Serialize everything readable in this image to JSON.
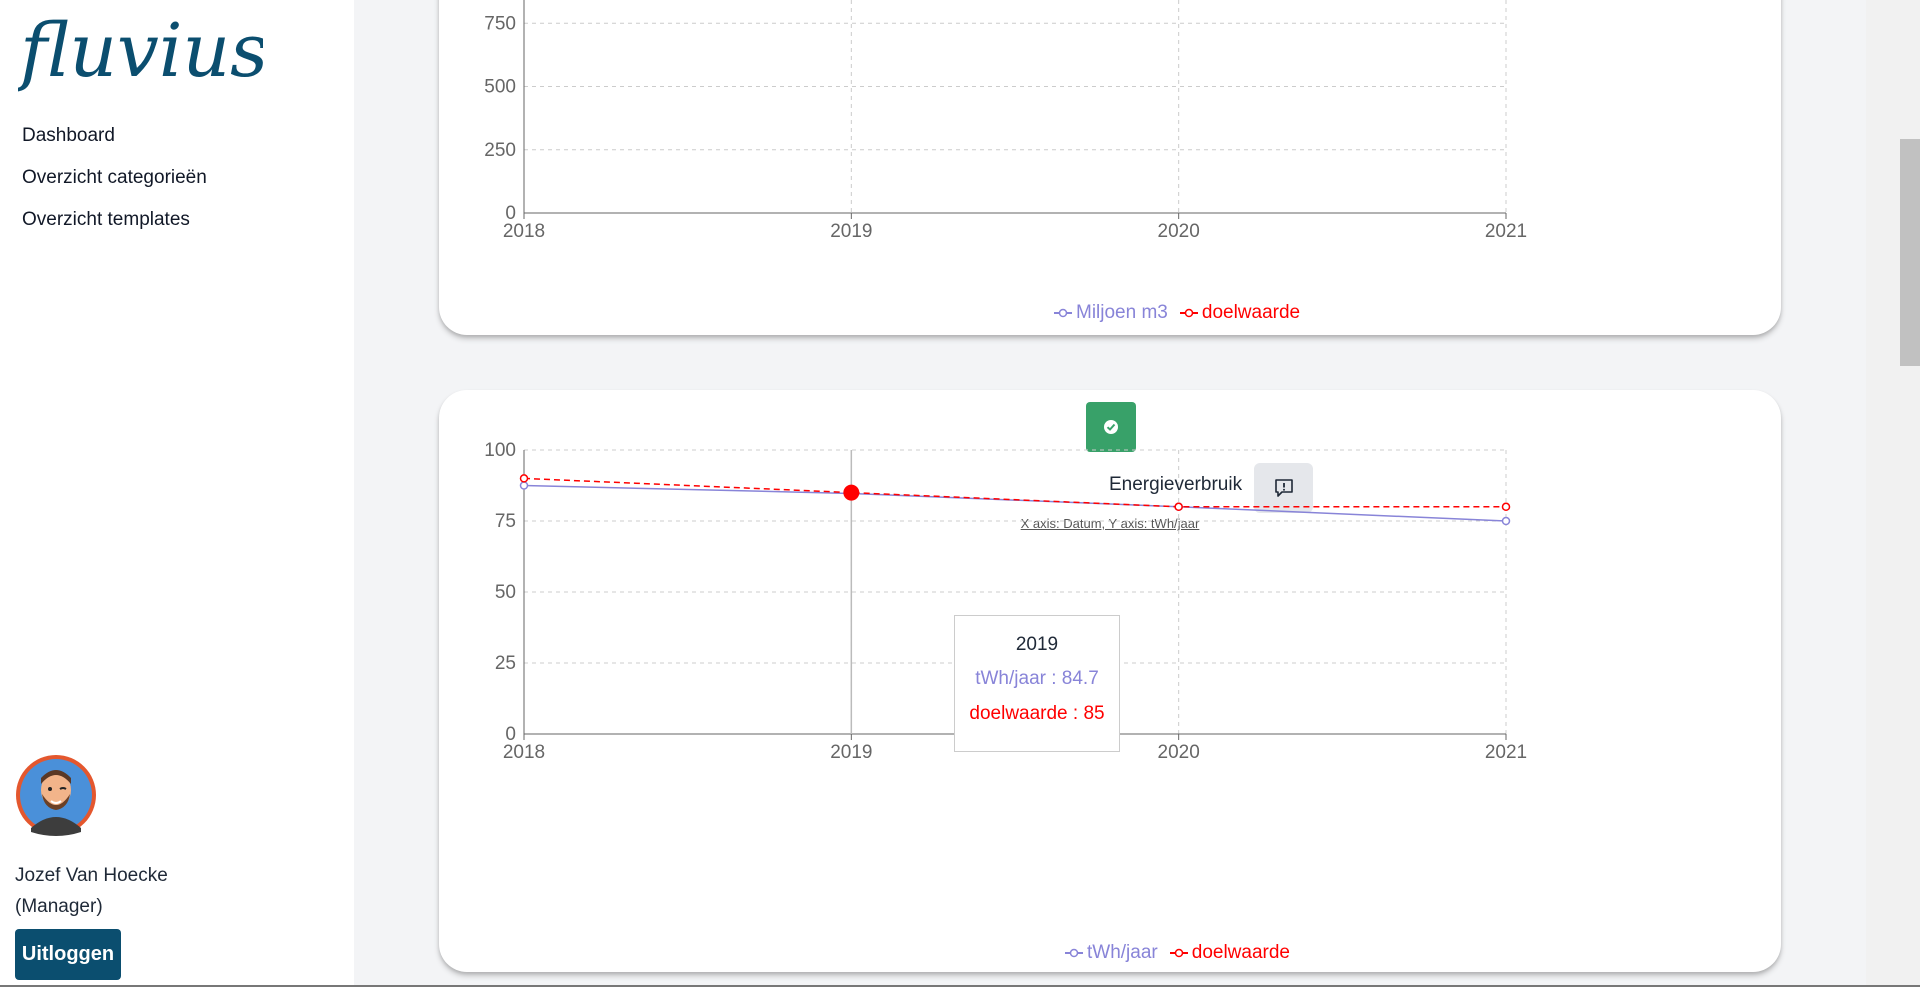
{
  "app": {
    "logo_text": "fluvius."
  },
  "sidebar": {
    "nav": [
      {
        "label": "Dashboard"
      },
      {
        "label": "Overzicht categorieën"
      },
      {
        "label": "Overzicht templates"
      }
    ],
    "user": {
      "name": "Jozef Van Hoecke",
      "role": "(Manager)"
    },
    "logout_label": "Uitloggen"
  },
  "charts": {
    "chart1": {
      "title": "",
      "axis_note": "",
      "legend": [
        {
          "name": "Miljoen m3",
          "color": "#8884d8"
        },
        {
          "name": "doelwaarde",
          "color": "#ff0000"
        }
      ]
    },
    "chart2": {
      "title": "Energieverbruik",
      "axis_note": "X axis: Datum, Y axis: tWh/jaar",
      "legend": [
        {
          "name": "tWh/jaar",
          "color": "#8884d8"
        },
        {
          "name": "doelwaarde",
          "color": "#ff0000"
        }
      ],
      "tooltip": {
        "year": "2019",
        "series_line": "tWh/jaar : 84.7",
        "target_line": "doelwaarde : 85"
      }
    }
  },
  "colors": {
    "brand": "#0b4e6f",
    "success": "#38a169",
    "series": "#8884d8",
    "target": "#ff0000"
  },
  "chart_data": [
    {
      "type": "line",
      "title": "",
      "x": [
        "2018",
        "2019",
        "2020",
        "2021"
      ],
      "xlabel": "",
      "ylabel": "",
      "yticks": [
        0,
        250,
        500,
        750
      ],
      "ylim": [
        0,
        1000
      ],
      "grid": true,
      "legend_position": "bottom",
      "series": [
        {
          "name": "Miljoen m3",
          "values": []
        },
        {
          "name": "doelwaarde",
          "values": []
        }
      ]
    },
    {
      "type": "line",
      "title": "Energieverbruik",
      "x": [
        "2018",
        "2019",
        "2020",
        "2021"
      ],
      "xlabel": "Datum",
      "ylabel": "tWh/jaar",
      "yticks": [
        0,
        25,
        50,
        75,
        100
      ],
      "ylim": [
        0,
        100
      ],
      "grid": true,
      "legend_position": "bottom",
      "series": [
        {
          "name": "tWh/jaar",
          "values": [
            87.5,
            84.7,
            80,
            75
          ]
        },
        {
          "name": "doelwaarde",
          "values": [
            90,
            85,
            80,
            80
          ]
        }
      ]
    }
  ]
}
